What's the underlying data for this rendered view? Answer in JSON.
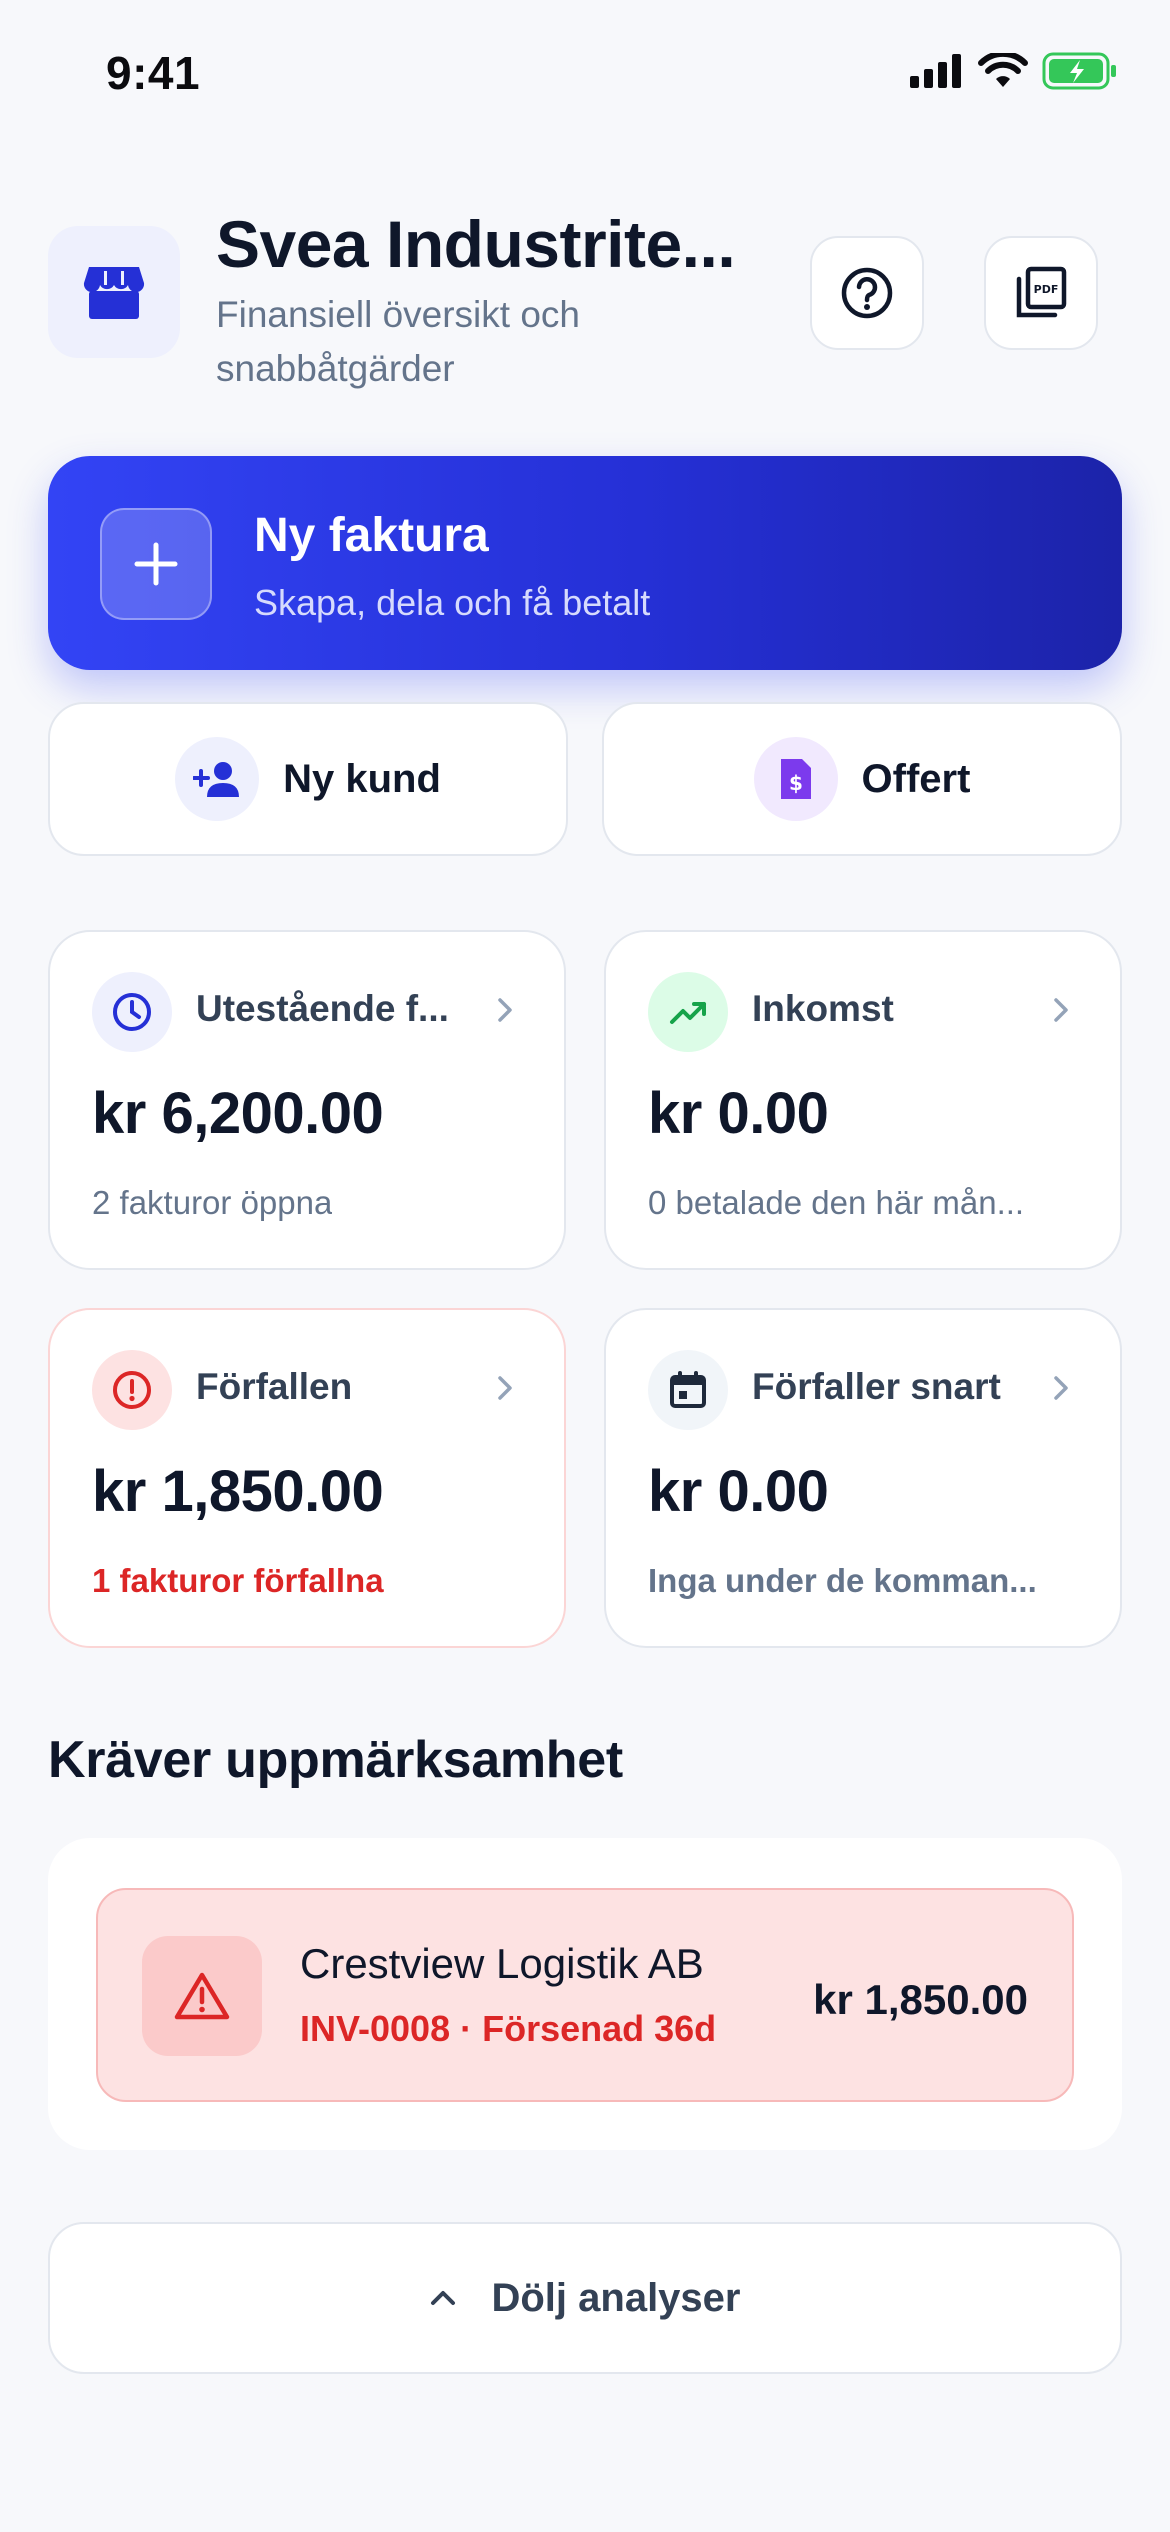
{
  "status_bar": {
    "time": "9:41"
  },
  "header": {
    "title": "Svea Industrite...",
    "subtitle": "Finansiell översikt och snabbåtgärder",
    "icons": {
      "store": "store-icon",
      "help": "help-circle-icon",
      "pdf": "pdf-icon"
    }
  },
  "cta": {
    "title": "Ny faktura",
    "subtitle": "Skapa, dela och få betalt"
  },
  "actions": [
    {
      "label": "Ny kund",
      "icon": "person-add-icon"
    },
    {
      "label": "Offert",
      "icon": "dollar-document-icon"
    }
  ],
  "stats": [
    {
      "label": "Utestående f...",
      "value": "kr 6,200.00",
      "note": "2 fakturor öppna",
      "icon": "clock-icon"
    },
    {
      "label": "Inkomst",
      "value": "kr 0.00",
      "note": "0 betalade den här mån...",
      "icon": "trending-up-icon"
    },
    {
      "label": "Förfallen",
      "value": "kr 1,850.00",
      "note": "1 fakturor förfallna",
      "icon": "alert-circle-icon"
    },
    {
      "label": "Förfaller snart",
      "value": "kr 0.00",
      "note": "Inga under de komman...",
      "icon": "calendar-icon"
    }
  ],
  "attention": {
    "title": "Kräver uppmärksamhet",
    "items": [
      {
        "name": "Crestview Logistik AB",
        "meta": "INV-0008 · Försenad 36d",
        "amount": "kr 1,850.00",
        "icon": "warning-triangle-icon"
      }
    ]
  },
  "toggle": {
    "label": "Dölj analyser",
    "icon": "chevron-up-icon"
  },
  "colors": {
    "accent": "#3344f5",
    "accent_dark": "#1c23a9",
    "danger": "#dc2626",
    "danger_bg": "#fde2e2",
    "success": "#16a34a",
    "purple": "#7c3aed"
  }
}
